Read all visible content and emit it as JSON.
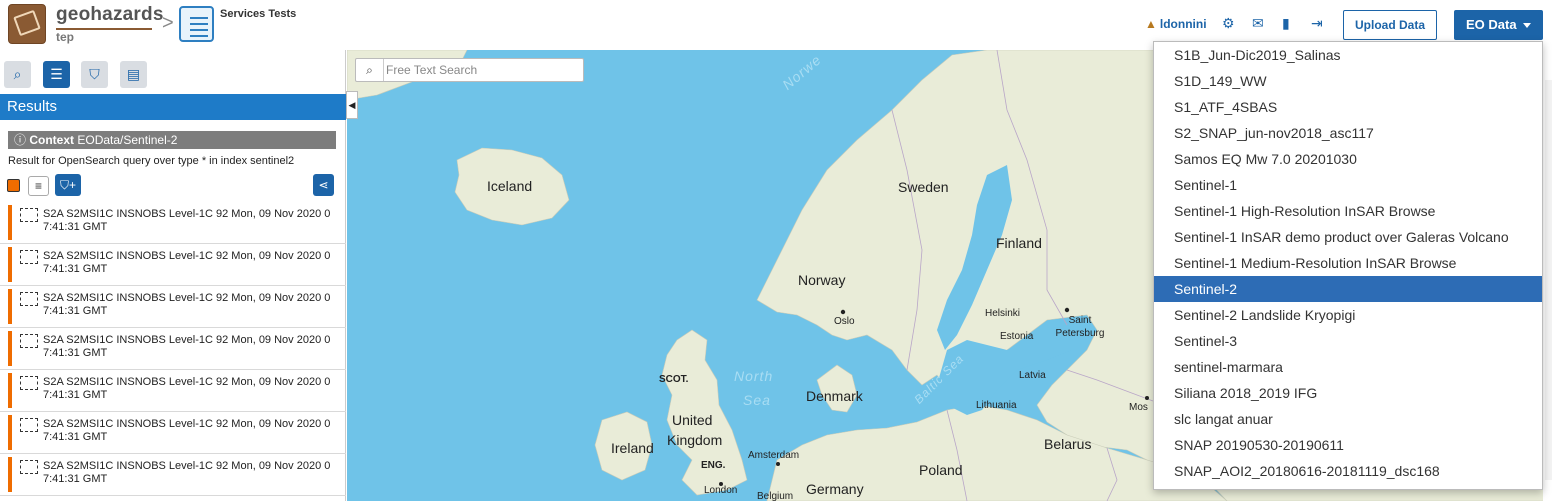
{
  "header": {
    "logo_name": "geohazards",
    "logo_sub": "tep",
    "breadcrumb_separator": ">",
    "service_title": "Services Tests",
    "username": "ldonnini",
    "upload_label": "Upload Data",
    "eo_label": "EO Data"
  },
  "sidebar": {
    "results_label": "Results",
    "context_label": "Context",
    "context_value": "EOData/Sentinel-2",
    "query_text": "Result for OpenSearch query over type * in index sentinel2",
    "items": [
      {
        "text": "S2A S2MSI1C INSNOBS Level-1C 92 Mon, 09 Nov 2020 07:41:31 GMT"
      },
      {
        "text": "S2A S2MSI1C INSNOBS Level-1C 92 Mon, 09 Nov 2020 07:41:31 GMT"
      },
      {
        "text": "S2A S2MSI1C INSNOBS Level-1C 92 Mon, 09 Nov 2020 07:41:31 GMT"
      },
      {
        "text": "S2A S2MSI1C INSNOBS Level-1C 92 Mon, 09 Nov 2020 07:41:31 GMT"
      },
      {
        "text": "S2A S2MSI1C INSNOBS Level-1C 92 Mon, 09 Nov 2020 07:41:31 GMT"
      },
      {
        "text": "S2A S2MSI1C INSNOBS Level-1C 92 Mon, 09 Nov 2020 07:41:31 GMT"
      },
      {
        "text": "S2A S2MSI1C INSNOBS Level-1C 92 Mon, 09 Nov 2020 07:41:31 GMT"
      }
    ]
  },
  "map": {
    "search_placeholder": "Free Text Search",
    "labels": {
      "iceland": "Iceland",
      "sweden": "Sweden",
      "finland": "Finland",
      "norway": "Norway",
      "oslo": "Oslo",
      "helsinki": "Helsinki",
      "saint_petersburg": "Saint Petersburg",
      "estonia": "Estonia",
      "latvia": "Latvia",
      "lithuania": "Lithuania",
      "belarus": "Belarus",
      "poland": "Poland",
      "germany": "Germany",
      "denmark": "Denmark",
      "scotland": "SCOT.",
      "england": "ENG.",
      "united_kingdom_1": "United",
      "united_kingdom_2": "Kingdom",
      "ireland": "Ireland",
      "amsterdam": "Amsterdam",
      "london": "London",
      "belgium": "Belgium",
      "north_sea_1": "North",
      "north_sea_2": "Sea",
      "baltic_sea": "Baltic Sea",
      "moscow_partial": "Mos",
      "norwegian_sea_partial": "Norwe"
    }
  },
  "dropdown": {
    "items": [
      {
        "label": "S1B_Jun-Dic2019_Salinas",
        "active": false
      },
      {
        "label": "S1D_149_WW",
        "active": false
      },
      {
        "label": "S1_ATF_4SBAS",
        "active": false
      },
      {
        "label": "S2_SNAP_jun-nov2018_asc117",
        "active": false
      },
      {
        "label": "Samos EQ Mw 7.0 20201030",
        "active": false
      },
      {
        "label": "Sentinel-1",
        "active": false
      },
      {
        "label": "Sentinel-1 High-Resolution InSAR Browse",
        "active": false
      },
      {
        "label": "Sentinel-1 InSAR demo product over Galeras Volcano",
        "active": false
      },
      {
        "label": "Sentinel-1 Medium-Resolution InSAR Browse",
        "active": false
      },
      {
        "label": "Sentinel-2",
        "active": true
      },
      {
        "label": "Sentinel-2 Landslide Kryopigi",
        "active": false
      },
      {
        "label": "Sentinel-3",
        "active": false
      },
      {
        "label": "sentinel-marmara",
        "active": false
      },
      {
        "label": "Siliana 2018_2019 IFG",
        "active": false
      },
      {
        "label": "slc langat anuar",
        "active": false
      },
      {
        "label": "SNAP 20190530-20190611",
        "active": false
      },
      {
        "label": "SNAP_AOI2_20180616-20181119_dsc168",
        "active": false
      }
    ]
  },
  "colors": {
    "accent": "#1c64a8",
    "results_bar": "#1e7bc8",
    "orange": "#ef6c00",
    "map_water": "#6fc3e8",
    "map_land": "#e9ecd8",
    "dropdown_active": "#2d6cb5"
  }
}
